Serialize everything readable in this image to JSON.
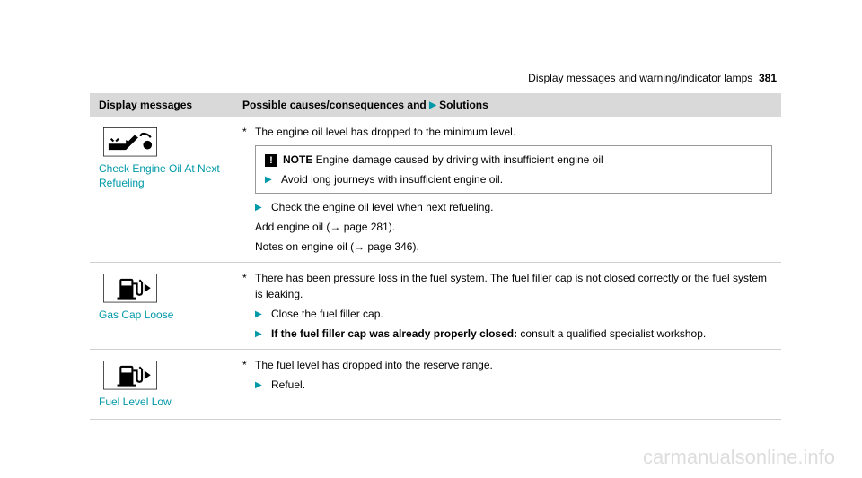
{
  "header": {
    "title": "Display messages and warning/indicator lamps",
    "page_number": "381"
  },
  "table": {
    "col1_header": "Display messages",
    "col2_header_prefix": "Possible causes/consequences and ",
    "col2_header_suffix": " Solutions"
  },
  "rows": [
    {
      "label": "Check Engine Oil At Next Refueling",
      "cause": "The engine oil level has dropped to the minimum level.",
      "note_label": "NOTE",
      "note_text": " Engine damage caused by driving with insufficient engine oil",
      "note_action": "Avoid long journeys with insufficient engine oil.",
      "action1": "Check the engine oil level when next refueling.",
      "extra1": "Add engine oil (→ page 281).",
      "extra2": "Notes on engine oil (→ page 346)."
    },
    {
      "label": "Gas Cap Loose",
      "cause": "There has been pressure loss in the fuel system. The fuel filler cap is not closed correctly or the fuel system is leaking.",
      "action1": "Close the fuel filler cap.",
      "action2_bold": "If the fuel filler cap was already properly closed:",
      "action2_rest": " consult a qualified specialist workshop."
    },
    {
      "label": "Fuel Level Low",
      "cause": "The fuel level has dropped into the reserve range.",
      "action1": "Refuel."
    }
  ],
  "watermark": "carmanualsonline.info"
}
